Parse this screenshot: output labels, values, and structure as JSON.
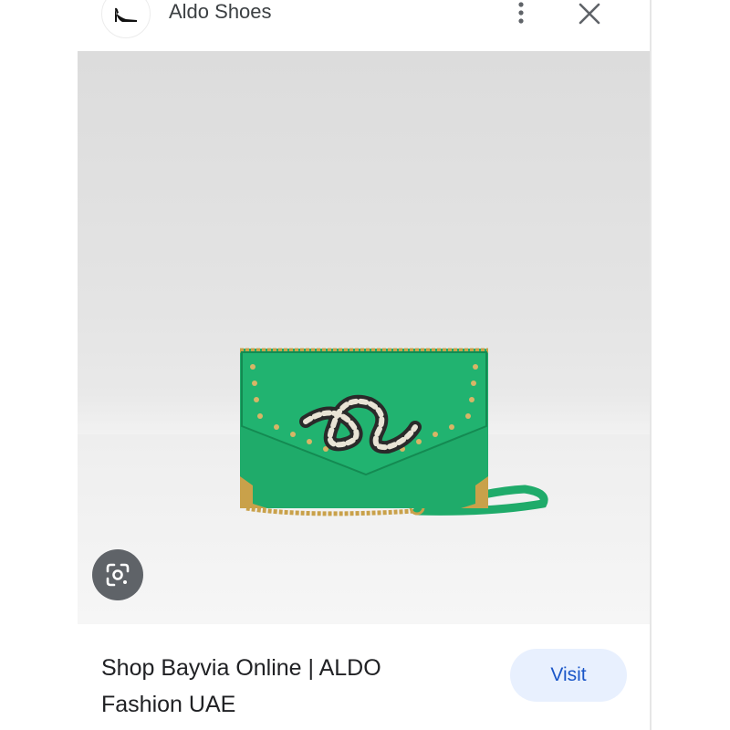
{
  "header": {
    "site_name": "Aldo Shoes",
    "icons": {
      "logo": "high-heel-shoe-icon",
      "more": "more-vert-icon",
      "close": "close-icon"
    }
  },
  "image": {
    "subject": "green-handbag-with-snake-emblem",
    "lens_icon": "google-lens-icon"
  },
  "result": {
    "title": "Shop Bayvia Online | ALDO Fashion UAE",
    "visit_label": "Visit"
  },
  "colors": {
    "bag_green": "#1fab6a",
    "visit_bg": "#e8f0fe",
    "visit_text": "#1a56c8",
    "gold": "#c9a14a"
  }
}
